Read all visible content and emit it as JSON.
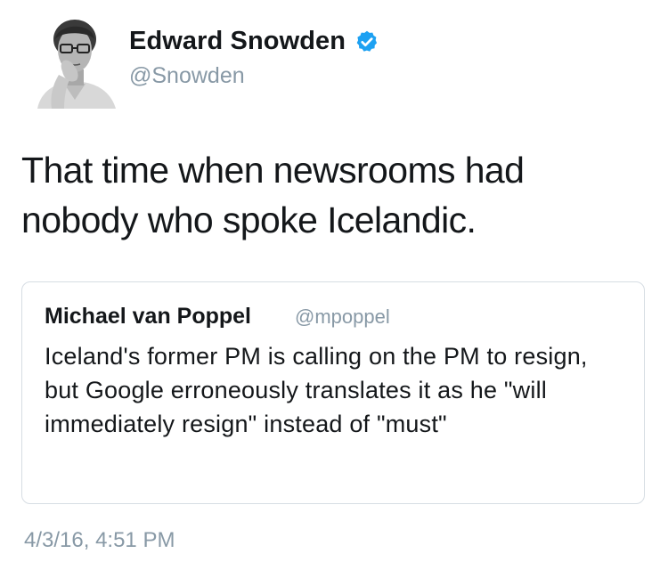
{
  "author": {
    "name": "Edward Snowden",
    "handle": "@Snowden",
    "verified": true
  },
  "tweet": {
    "text": "That time when newsrooms had nobody who spoke Icelandic.",
    "timestamp": "4/3/16, 4:51 PM"
  },
  "quoted_tweet": {
    "name": "Michael van Poppel",
    "handle": "@mpoppel",
    "text": "Iceland's former PM is calling on the PM to resign, but Google erroneously translates it as he \"will immediately resign\" instead of \"must\""
  },
  "colors": {
    "verified_badge": "#1da1f2",
    "secondary_text": "#8899a6",
    "quote_border": "#d6dde3"
  }
}
